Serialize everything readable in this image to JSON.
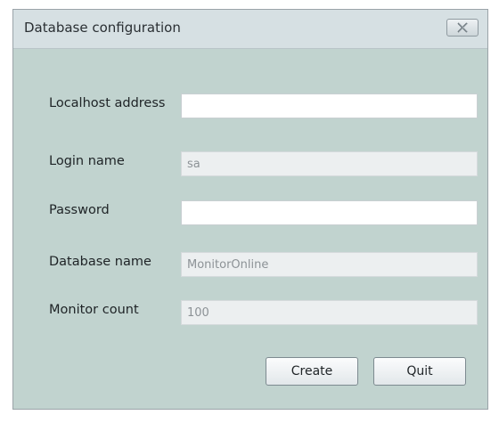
{
  "window": {
    "title": "Database configuration",
    "close_icon": "close-x-icon"
  },
  "form": {
    "fields": [
      {
        "label": "Localhost address",
        "value": "",
        "editable": true
      },
      {
        "label": "Login name",
        "value": "sa",
        "editable": false
      },
      {
        "label": "Password",
        "value": "",
        "editable": true
      },
      {
        "label": "Database name",
        "value": "MonitorOnline",
        "editable": false
      },
      {
        "label": "Monitor count",
        "value": "100",
        "editable": false
      }
    ]
  },
  "buttons": {
    "create_label": "Create",
    "quit_label": "Quit"
  },
  "colors": {
    "panel_background": "#c1d3cf",
    "titlebar_background": "#d6e0e3",
    "readonly_field": "#eceff0",
    "editable_field": "#ffffff"
  }
}
